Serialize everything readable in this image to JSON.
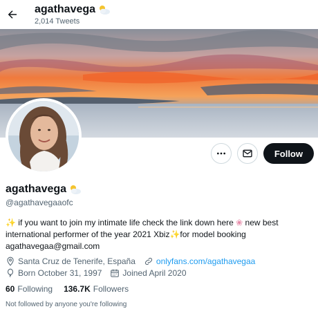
{
  "header": {
    "display_name": "agathavega",
    "tweet_count": "2,014 Tweets"
  },
  "profile": {
    "display_name": "agathavega",
    "handle": "@agathavegaaofc",
    "bio_line1_part1": "if you want to join my intimate life check the link down here",
    "bio_line1_part2": "new best",
    "bio_line2_part1": "international performer of the year 2021 Xbiz",
    "bio_line2_part2": "for model booking",
    "bio_line3": "agathavegaa@gmail.com",
    "location": "Santa Cruz de Tenerife, España",
    "website": "onlyfans.com/agathavegaa",
    "born": "Born October 31, 1997",
    "joined": "Joined April 2020",
    "following_count": "60",
    "following_label": "Following",
    "followers_count": "136.7K",
    "followers_label": "Followers",
    "not_followed_text": "Not followed by anyone you're following"
  },
  "actions": {
    "follow_label": "Follow"
  },
  "icons": {
    "back": "arrow-left-icon",
    "more": "more-icon",
    "message": "envelope-icon",
    "location": "location-pin-icon",
    "link": "link-icon",
    "born": "balloon-icon",
    "joined": "calendar-icon"
  },
  "colors": {
    "accent": "#1d9bf0",
    "text": "#0f1419",
    "muted": "#536471",
    "follow_bg": "#0f1419"
  }
}
